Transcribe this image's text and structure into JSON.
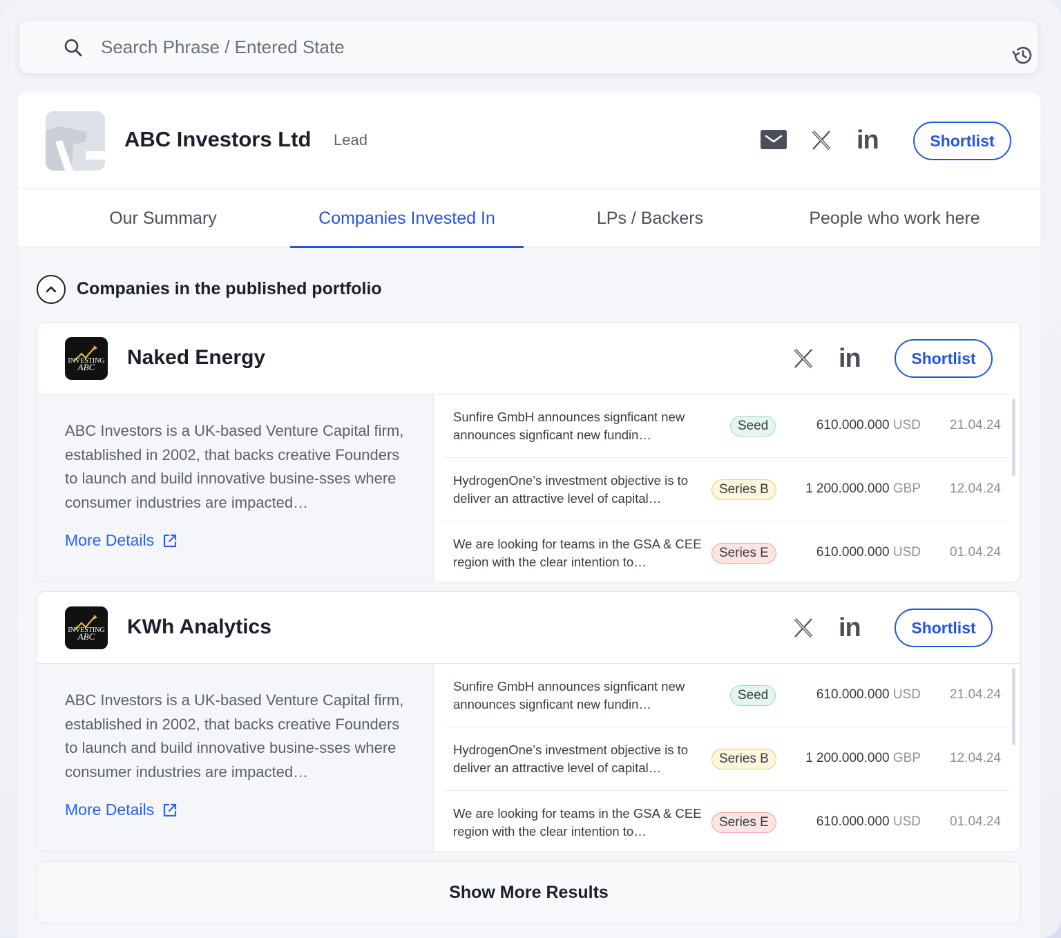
{
  "search": {
    "placeholder": "Search Phrase / Entered State"
  },
  "firm": {
    "name": "ABC Investors Ltd",
    "tag": "Lead",
    "shortlist_label": "Shortlist"
  },
  "tabs": [
    {
      "label": "Our Summary",
      "active": false
    },
    {
      "label": "Companies Invested In",
      "active": true
    },
    {
      "label": "LPs / Backers",
      "active": false
    },
    {
      "label": "People who work here",
      "active": false
    }
  ],
  "section": {
    "title": "Companies in the published portfolio"
  },
  "companies": [
    {
      "name": "Naked Energy",
      "logo_text": "INVESTING ABC",
      "shortlist_label": "Shortlist",
      "description": "ABC Investors is a UK-based Venture Capital firm, established in 2002, that backs creative Founders to launch and build innovative busine-sses where consumer industries are impacted…",
      "more_label": "More Details",
      "deals": [
        {
          "text": "Sunfire GmbH announces signficant new  announces signficant new fundin…",
          "stage": "Seed",
          "amount": "610.000.000",
          "currency": "USD",
          "date": "21.04.24"
        },
        {
          "text": "HydrogenOne’s investment objective is to deliver an attractive level of capital…",
          "stage": "Series B",
          "amount": "1 200.000.000",
          "currency": "GBP",
          "date": "12.04.24"
        },
        {
          "text": "We are looking for teams in the GSA & CEE region with the clear intention to…",
          "stage": "Series E",
          "amount": "610.000.000",
          "currency": "USD",
          "date": "01.04.24"
        }
      ]
    },
    {
      "name": "KWh Analytics",
      "logo_text": "INVESTING ABC",
      "shortlist_label": "Shortlist",
      "description": "ABC Investors is a UK-based Venture Capital firm, established in 2002, that backs creative Founders to launch and build innovative busine-sses where consumer industries are impacted…",
      "more_label": "More Details",
      "deals": [
        {
          "text": "Sunfire GmbH announces signficant new  announces signficant new fundin…",
          "stage": "Seed",
          "amount": "610.000.000",
          "currency": "USD",
          "date": "21.04.24"
        },
        {
          "text": "HydrogenOne’s investment objective is to deliver an attractive level of capital…",
          "stage": "Series B",
          "amount": "1 200.000.000",
          "currency": "GBP",
          "date": "12.04.24"
        },
        {
          "text": "We are looking for teams in the GSA & CEE region with the clear intention to…",
          "stage": "Series E",
          "amount": "610.000.000",
          "currency": "USD",
          "date": "01.04.24"
        }
      ]
    }
  ],
  "show_more_label": "Show More Results",
  "colors": {
    "accent": "#2456d6",
    "link": "#2d63e0",
    "seed": "#e4f6ee",
    "series_b": "#fbf6dc",
    "series_e": "#fde4e4"
  }
}
